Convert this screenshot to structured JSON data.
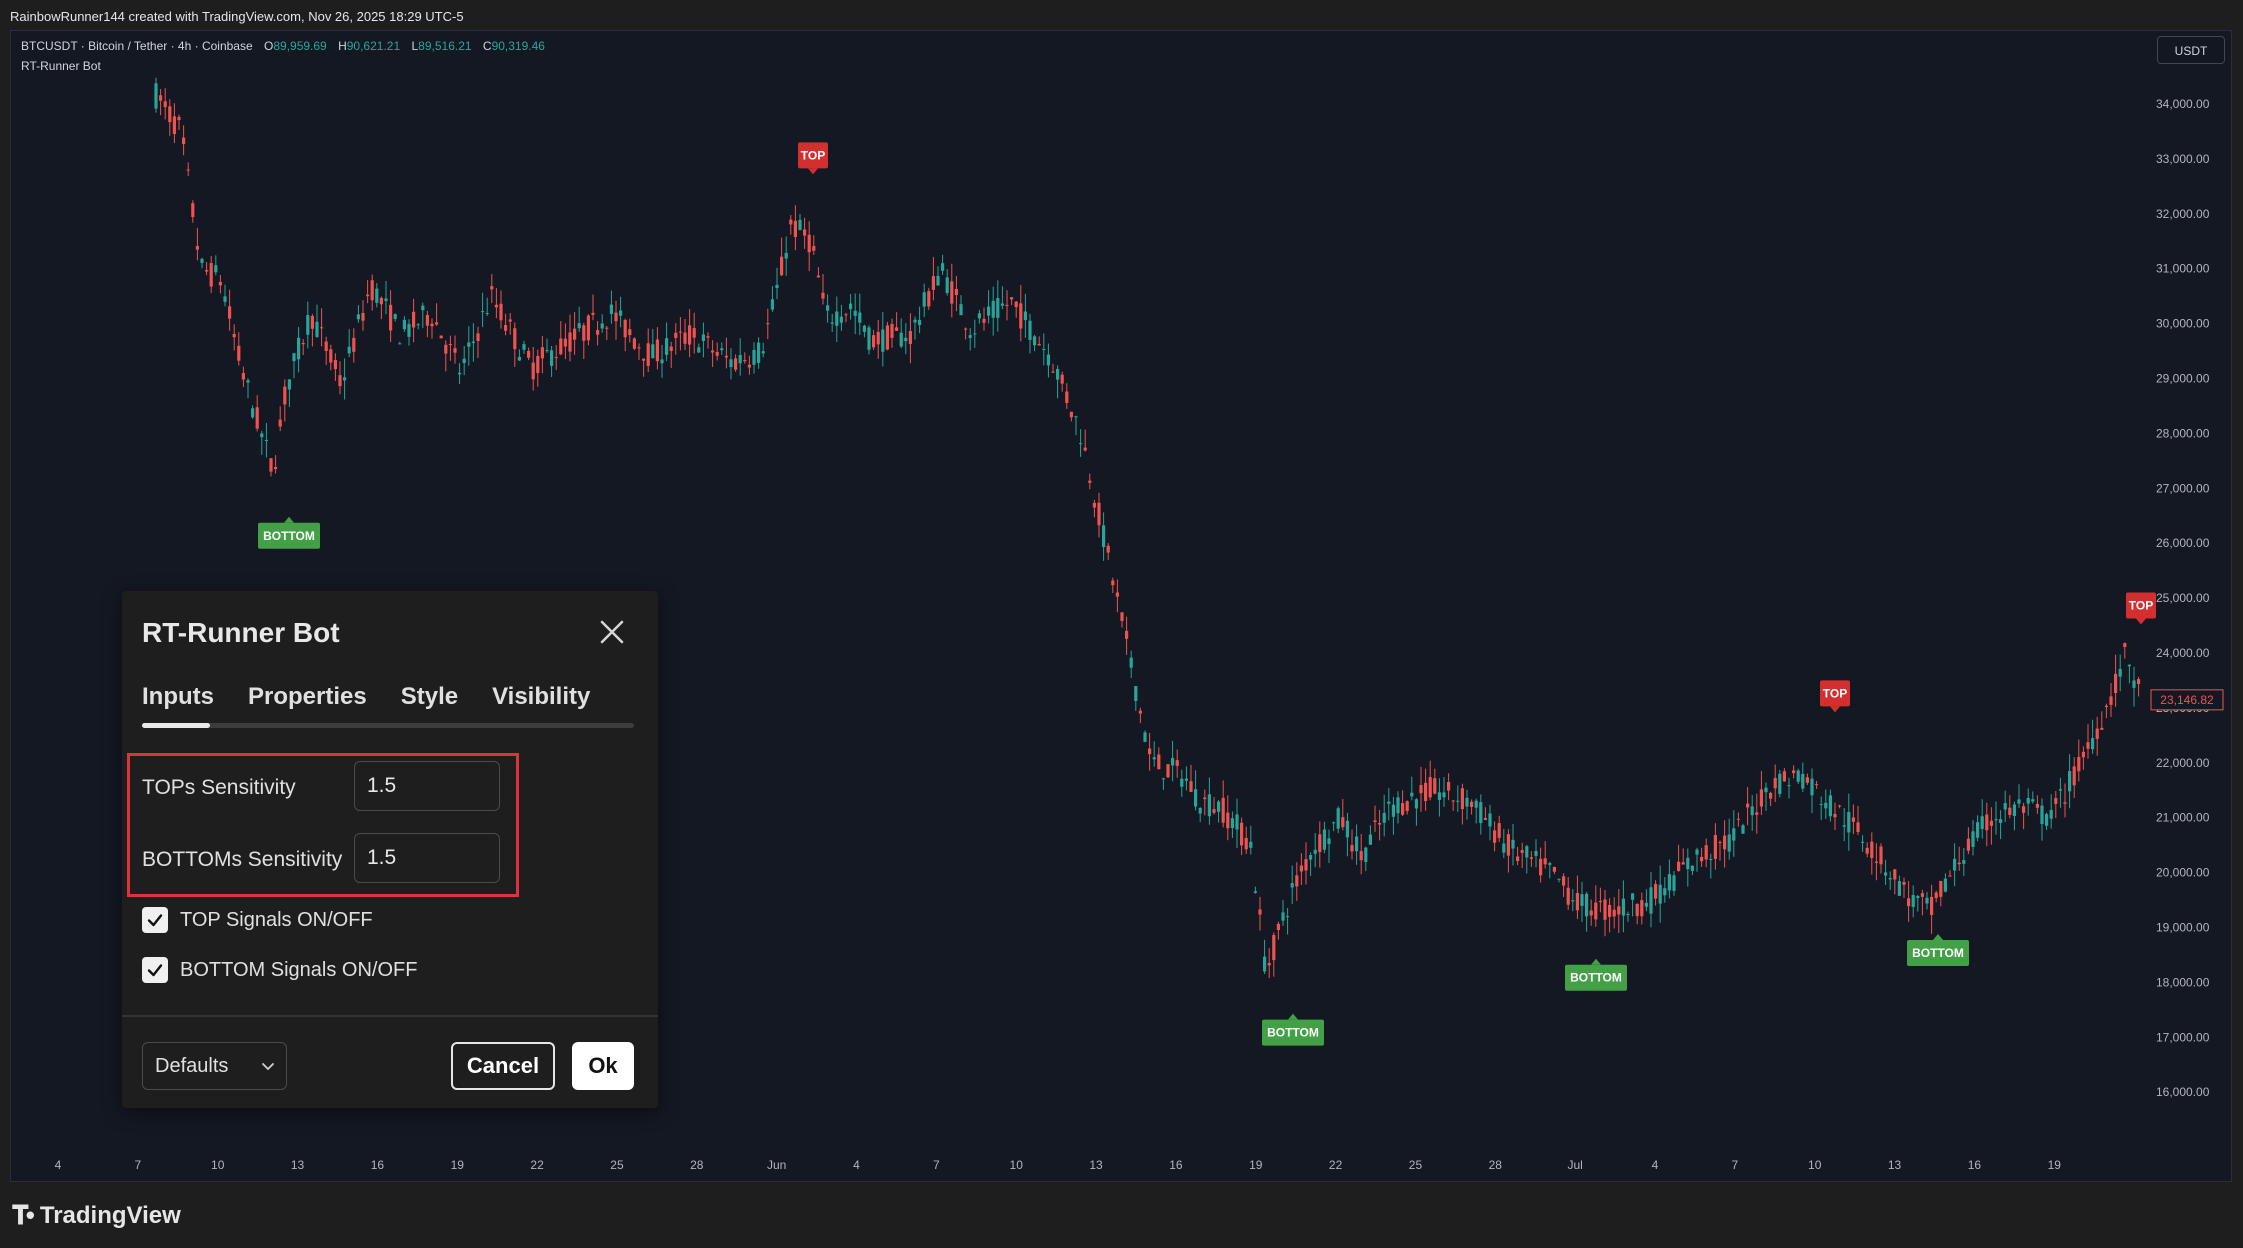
{
  "header": {
    "attribution": "RainbowRunner144 created with TradingView.com, Nov 26, 2025 18:29 UTC-5"
  },
  "symbol": {
    "description": "BTCUSDT · Bitcoin / Tether · 4h · Coinbase",
    "open_label": "O",
    "open": "89,959.69",
    "high_label": "H",
    "high": "90,621.21",
    "low_label": "L",
    "low": "89,516.21",
    "close_label": "C",
    "close": "90,319.46"
  },
  "indicator": {
    "name": "RT-Runner Bot"
  },
  "currency_button": "USDT",
  "price_axis": {
    "labels": [
      "34,000.00",
      "33,000.00",
      "32,000.00",
      "31,000.00",
      "30,000.00",
      "29,000.00",
      "28,000.00",
      "27,000.00",
      "26,000.00",
      "25,000.00",
      "24,000.00",
      "23,000.00",
      "22,000.00",
      "21,000.00",
      "20,000.00",
      "19,000.00",
      "18,000.00",
      "17,000.00",
      "16,000.00"
    ],
    "current_price": "23,146.82"
  },
  "time_axis": {
    "labels": [
      "4",
      "7",
      "10",
      "13",
      "16",
      "19",
      "22",
      "25",
      "28",
      "Jun",
      "4",
      "7",
      "10",
      "13",
      "16",
      "19",
      "22",
      "25",
      "28",
      "Jul",
      "4",
      "7",
      "10",
      "13",
      "16",
      "19"
    ]
  },
  "signals": [
    {
      "type": "BOTTOM",
      "label": "BOTTOM",
      "price": 26700
    },
    {
      "type": "TOP",
      "label": "TOP",
      "price": 32500
    },
    {
      "type": "BOTTOM",
      "label": "BOTTOM",
      "price": 17650
    },
    {
      "type": "BOTTOM",
      "label": "BOTTOM",
      "price": 18650
    },
    {
      "type": "TOP",
      "label": "TOP",
      "price": 22700
    },
    {
      "type": "BOTTOM",
      "label": "BOTTOM",
      "price": 19100
    },
    {
      "type": "TOP",
      "label": "TOP",
      "price": 24300
    }
  ],
  "colors": {
    "up": "#26a69a",
    "down": "#ef5350",
    "top_label": "#d32f2f",
    "bottom_label": "#43a047",
    "background": "#141823"
  },
  "dialog": {
    "title": "RT-Runner Bot",
    "tabs": [
      "Inputs",
      "Properties",
      "Style",
      "Visibility"
    ],
    "active_tab": "Inputs",
    "tops_label": "TOPs Sensitivity",
    "tops_value": "1.5",
    "bottoms_label": "BOTTOMs Sensitivity",
    "bottoms_value": "1.5",
    "top_signals_label": "TOP Signals ON/OFF",
    "top_signals_checked": true,
    "bottom_signals_label": "BOTTOM Signals ON/OFF",
    "bottom_signals_checked": true,
    "defaults_label": "Defaults",
    "cancel_label": "Cancel",
    "ok_label": "Ok"
  },
  "footer": {
    "brand": "TradingView"
  }
}
